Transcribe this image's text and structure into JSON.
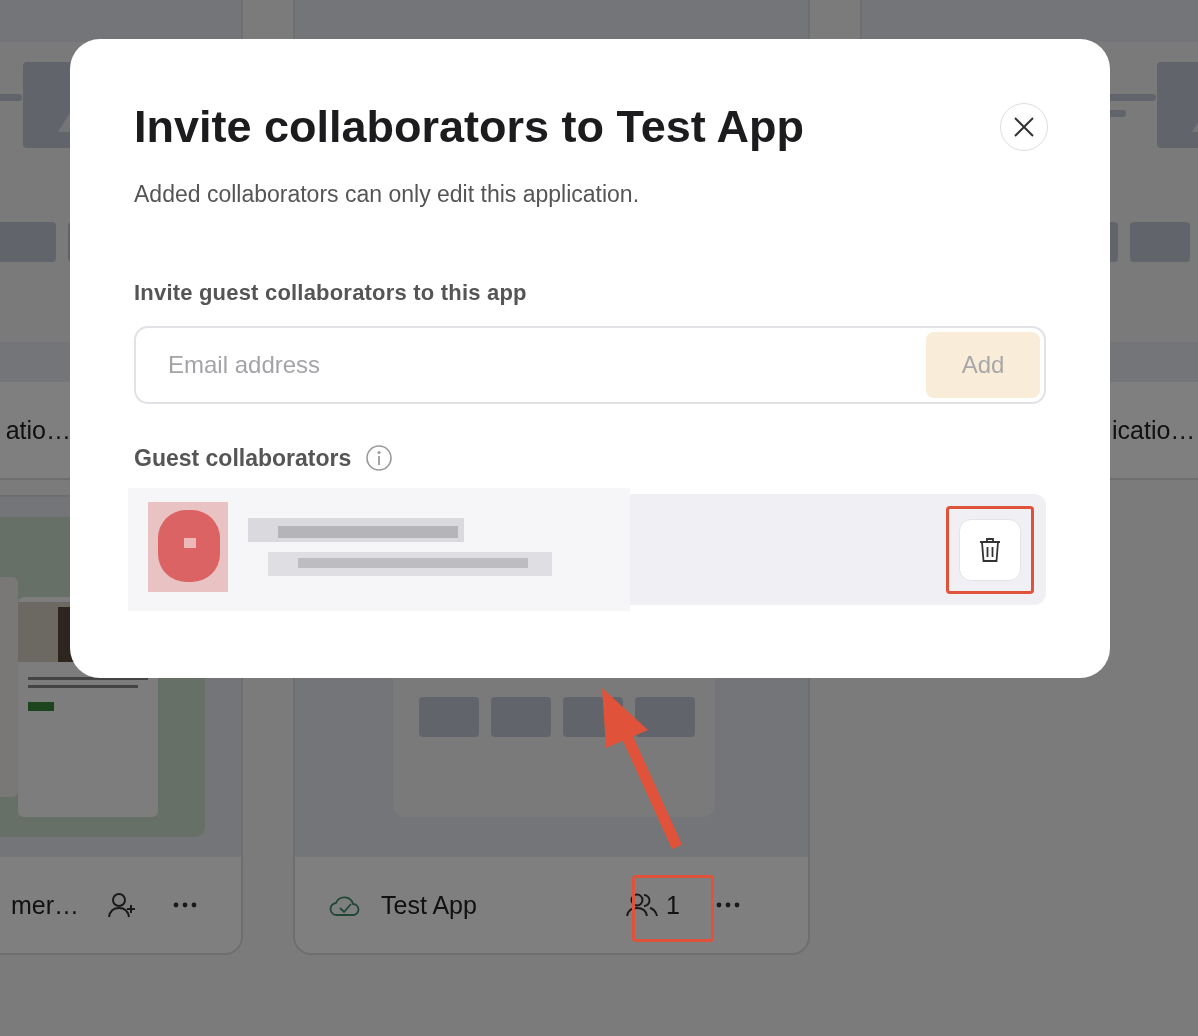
{
  "background_cards": [
    {
      "kind": "wireframe",
      "label": "atio…"
    },
    {
      "kind": "empty"
    },
    {
      "kind": "wireframe",
      "label": "icatio…"
    },
    {
      "kind": "picture",
      "label": "mer…",
      "actions": [
        {
          "kind": "invite"
        },
        {
          "kind": "more"
        }
      ]
    },
    {
      "kind": "wireframe",
      "label": "Test App",
      "synced": true,
      "actions": [
        {
          "kind": "collaborators",
          "count": "1",
          "annotated": true
        },
        {
          "kind": "more"
        }
      ]
    }
  ],
  "dialog": {
    "title": "Invite collaborators to Test App",
    "subtitle": "Added collaborators can only edit this application.",
    "invite_label": "Invite guest collaborators to this app",
    "email_field": {
      "placeholder": "Email address"
    },
    "add_button": {
      "label": "Add",
      "disabled": true
    },
    "guests_heading": "Guest collaborators",
    "guests": [
      {
        "kind": "redacted",
        "delete_annotated": true
      }
    ]
  }
}
